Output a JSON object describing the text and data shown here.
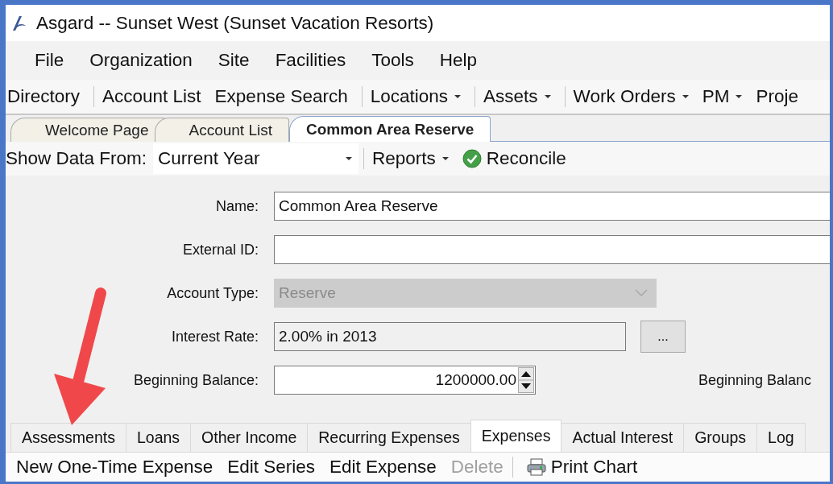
{
  "window": {
    "title": "Asgard -- Sunset West (Sunset Vacation Resorts)"
  },
  "menu": [
    "File",
    "Organization",
    "Site",
    "Facilities",
    "Tools",
    "Help"
  ],
  "toolbar": [
    [
      {
        "label": "Directory",
        "dropdown": false
      }
    ],
    [
      {
        "label": "Account List",
        "dropdown": false
      },
      {
        "label": "Expense Search",
        "dropdown": false
      }
    ],
    [
      {
        "label": "Locations",
        "dropdown": true
      }
    ],
    [
      {
        "label": "Assets",
        "dropdown": true
      }
    ],
    [
      {
        "label": "Work Orders",
        "dropdown": true
      },
      {
        "label": "PM",
        "dropdown": true
      },
      {
        "label": "Proje",
        "dropdown": false
      }
    ]
  ],
  "document_tabs": [
    {
      "label": "Welcome Page",
      "selected": false
    },
    {
      "label": "Account List",
      "selected": false
    },
    {
      "label": "Common Area Reserve",
      "selected": true
    }
  ],
  "filter_bar": {
    "label": "Show Data From:",
    "value": "Current Year",
    "reports": "Reports",
    "reconcile": "Reconcile"
  },
  "form": {
    "fields": [
      {
        "kind": "text",
        "label": "Name:",
        "value": "Common Area Reserve"
      },
      {
        "kind": "text",
        "label": "External ID:"
      },
      {
        "kind": "dropdown",
        "label": "Account Type:",
        "value": "Reserve",
        "disabled": true
      },
      {
        "kind": "picker",
        "label": "Interest Rate:",
        "value": "2.00% in 2013",
        "button": "..."
      },
      {
        "kind": "spinner",
        "label": "Beginning Balance:",
        "value": "1200000.00",
        "side_label": "Beginning Balanc"
      }
    ]
  },
  "section_tabs": [
    {
      "label": "Assessments",
      "selected": false
    },
    {
      "label": "Loans",
      "selected": false
    },
    {
      "label": "Other Income",
      "selected": false
    },
    {
      "label": "Recurring Expenses",
      "selected": false
    },
    {
      "label": "Expenses",
      "selected": true
    },
    {
      "label": "Actual Interest",
      "selected": false
    },
    {
      "label": "Groups",
      "selected": false
    },
    {
      "label": "Log",
      "selected": false
    }
  ],
  "action_bar": {
    "actions": [
      {
        "label": "New One-Time Expense",
        "disabled": false
      },
      {
        "label": "Edit Series",
        "disabled": false
      },
      {
        "label": "Edit Expense",
        "disabled": false
      },
      {
        "label": "Delete",
        "disabled": true
      }
    ],
    "print": "Print Chart"
  }
}
